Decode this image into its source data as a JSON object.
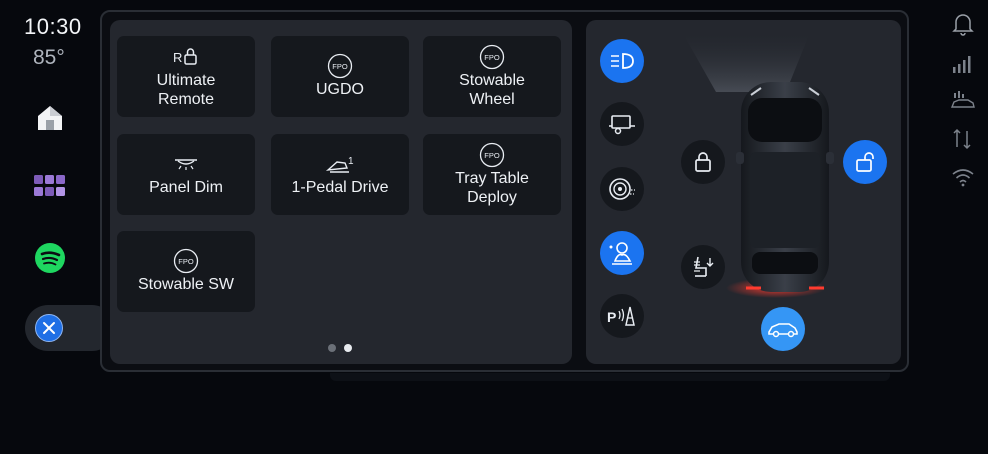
{
  "status": {
    "time": "10:30",
    "temperature": "85°"
  },
  "left_rail": {
    "items": [
      {
        "icon": "home-icon"
      },
      {
        "icon": "apps-grid-icon"
      },
      {
        "icon": "spotify-icon"
      }
    ],
    "close_icon": "close-icon"
  },
  "apps": {
    "tiles": [
      {
        "id": "ultimate-remote",
        "label": "Ultimate\nRemote",
        "icon": "remote-lock-icon"
      },
      {
        "id": "ugdo",
        "label": "UGDO",
        "icon": "fpo-icon",
        "icon_text": "FPO"
      },
      {
        "id": "stowable-wheel",
        "label": "Stowable\nWheel",
        "icon": "fpo-icon",
        "icon_text": "FPO"
      },
      {
        "id": "panel-dim",
        "label": "Panel Dim",
        "icon": "panel-dim-icon"
      },
      {
        "id": "one-pedal-drive",
        "label": "1-Pedal Drive",
        "icon": "one-pedal-icon"
      },
      {
        "id": "tray-table-deploy",
        "label": "Tray Table\nDeploy",
        "icon": "fpo-icon",
        "icon_text": "FPO"
      },
      {
        "id": "stowable-sw",
        "label": "Stowable SW",
        "icon": "fpo-icon",
        "icon_text": "FPO"
      }
    ],
    "page_dots": {
      "count": 2,
      "active_index": 1
    }
  },
  "vehicle_controls": {
    "left_column": [
      {
        "id": "headlights",
        "icon": "headlight-icon",
        "active": true
      },
      {
        "id": "trailer",
        "icon": "trailer-icon",
        "active": false
      },
      {
        "id": "tire-pressure",
        "icon": "tire-icon",
        "active": false
      },
      {
        "id": "driver-assist",
        "icon": "driver-assist-icon",
        "active": true
      },
      {
        "id": "park-assist",
        "icon": "park-assist-icon",
        "active": false,
        "text": "P"
      }
    ],
    "lock": {
      "icon": "lock-icon",
      "active": false
    },
    "unlock": {
      "icon": "unlock-icon",
      "active": true
    },
    "seat_heat": {
      "icon": "seat-heat-icon",
      "active": false
    },
    "vehicle_view": {
      "icon": "vehicle-side-icon",
      "active": true
    },
    "colors": {
      "active": "#1b74f0",
      "panel": "#24272e",
      "tile": "#15181d"
    }
  },
  "right_rail": {
    "icons": [
      "bell-icon",
      "signal-bars-icon",
      "vehicle-signal-icon",
      "data-transfer-icon",
      "wifi-icon"
    ]
  }
}
